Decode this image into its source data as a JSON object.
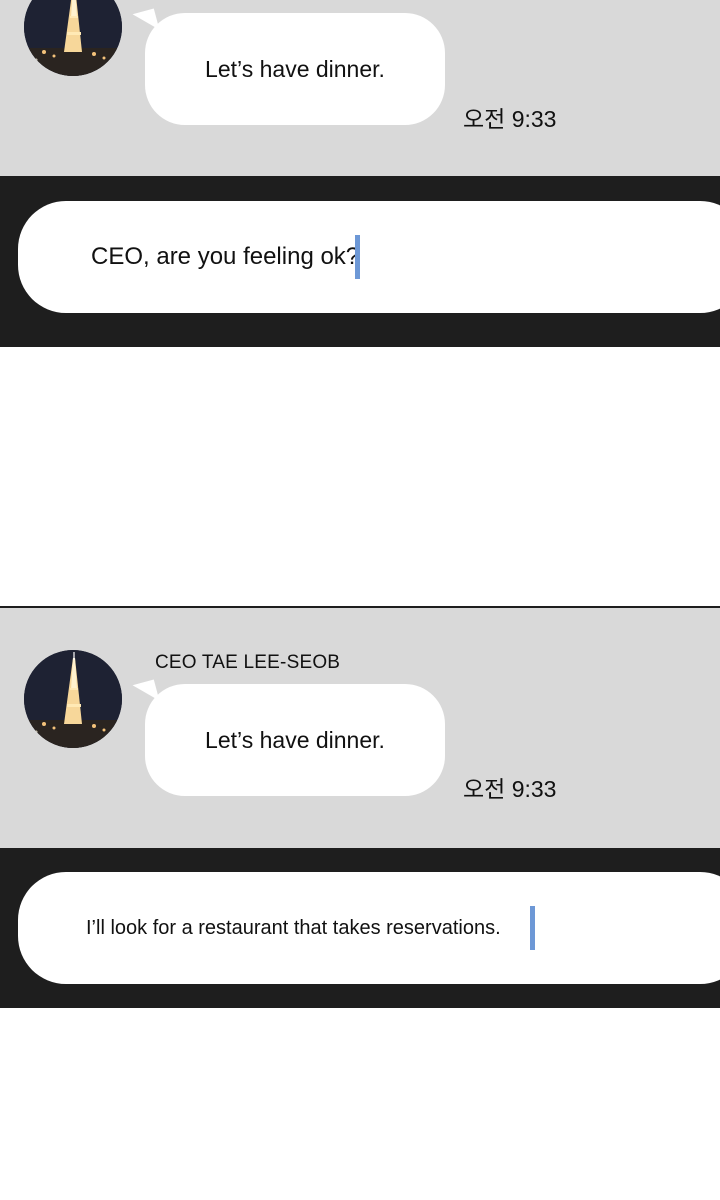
{
  "panels": [
    {
      "sender_name": "",
      "message": "Let’s have dinner.",
      "timestamp": "오전 9:33",
      "input_text": "CEO, are you feeling ok?"
    },
    {
      "sender_name": "CEO TAE LEE-SEOB",
      "message": "Let’s have dinner.",
      "timestamp": "오전 9:33",
      "input_text": "I’ll look for a restaurant that takes reservations."
    }
  ],
  "colors": {
    "chat_background": "#d9d9d9",
    "input_bar": "#1e1e1e",
    "bubble": "#ffffff",
    "caret": "#6d98d6"
  },
  "icons": {
    "avatar": "eiffel-tower-night-icon"
  }
}
